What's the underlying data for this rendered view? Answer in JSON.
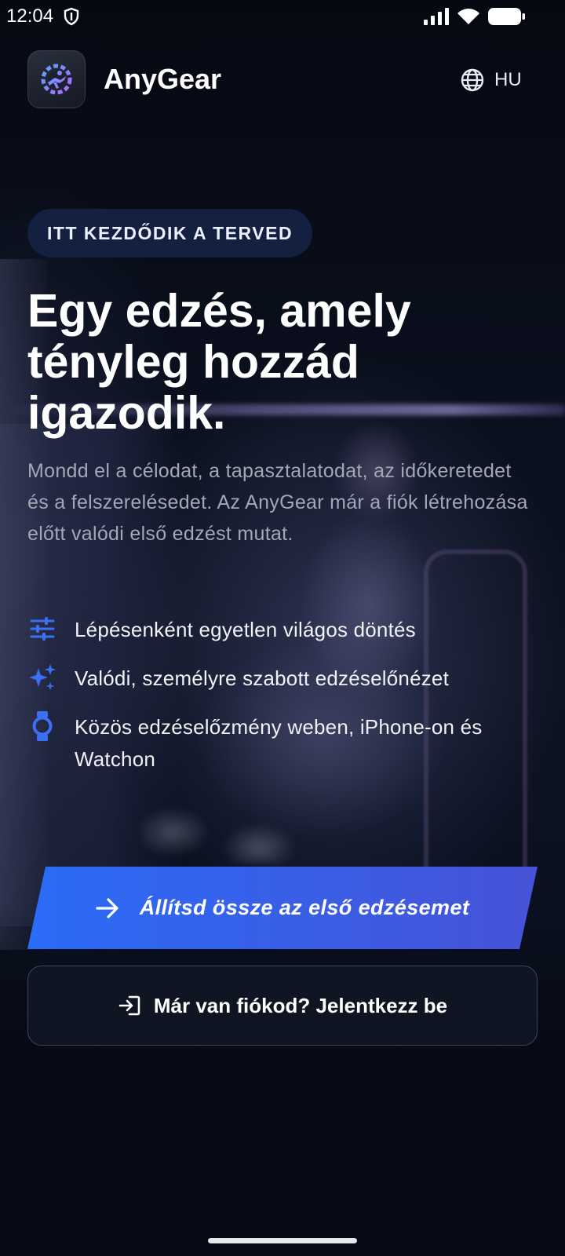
{
  "status_bar": {
    "time": "12:04"
  },
  "header": {
    "app_name": "AnyGear",
    "language": "HU"
  },
  "hero": {
    "badge": "ITT KEZDŐDIK A TERVED",
    "headline": "Egy edzés, amely tényleg hozzád igazodik.",
    "subtitle": "Mondd el a célodat, a tapasztalatodat, az időkeretedet és a felszerelésedet. Az AnyGear már a fiók létrehozása előtt valódi első edzést mutat."
  },
  "features": [
    {
      "icon": "sliders-icon",
      "text": "Lépésenként egyetlen világos döntés"
    },
    {
      "icon": "sparkles-icon",
      "text": "Valódi, személyre szabott edzéselőnézet"
    },
    {
      "icon": "watch-icon",
      "text": "Közös edzéselőzmény weben, iPhone-on és Watchon"
    }
  ],
  "actions": {
    "primary_label": "Állítsd össze az első edzésemet",
    "secondary_label": "Már van fiókod? Jelentkezz be"
  },
  "colors": {
    "accent": "#2f6bf2",
    "icon_blue": "#3d6ff5",
    "background": "#070b16"
  }
}
